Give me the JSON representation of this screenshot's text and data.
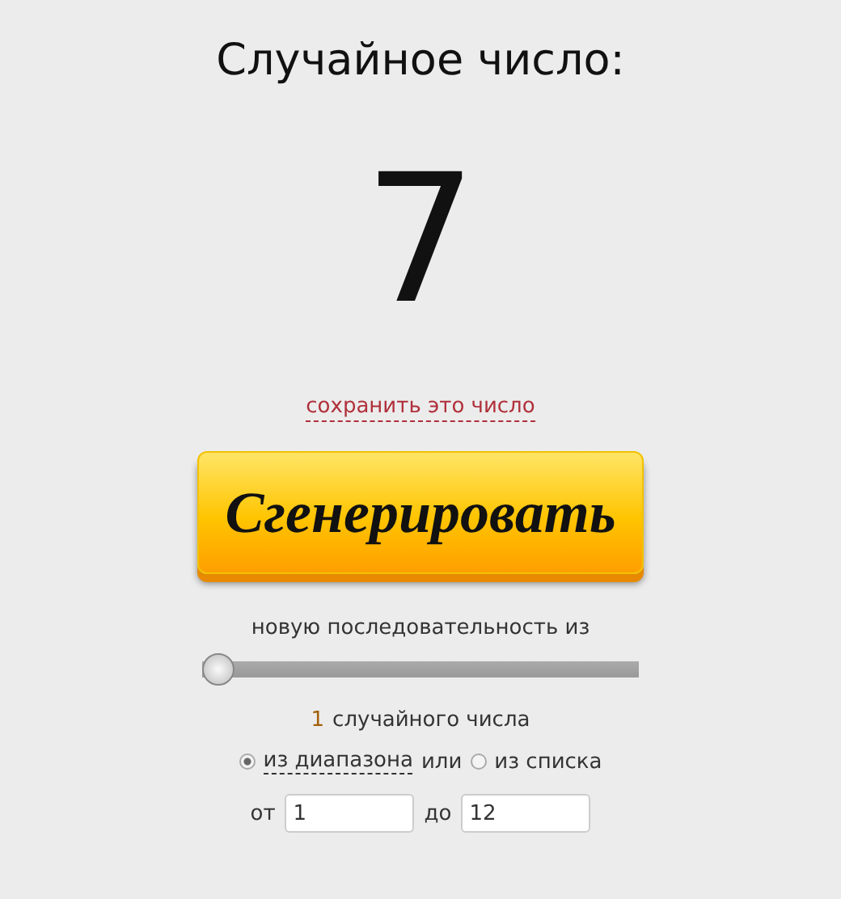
{
  "title": "Случайное число:",
  "result": "7",
  "save_link": "сохранить это число",
  "generate_button": "Сгенерировать",
  "sequence_label": "новую последовательность из",
  "slider": {
    "level": 0
  },
  "count": "1",
  "count_label": "случайного числа",
  "sources": [
    {
      "label": "из диапазона",
      "selected": true
    },
    {
      "label": "из списка",
      "selected": false
    }
  ],
  "joiner": "или",
  "range": {
    "from_label": "от",
    "from_value": "1",
    "to_label": "до",
    "to_value": "12"
  }
}
